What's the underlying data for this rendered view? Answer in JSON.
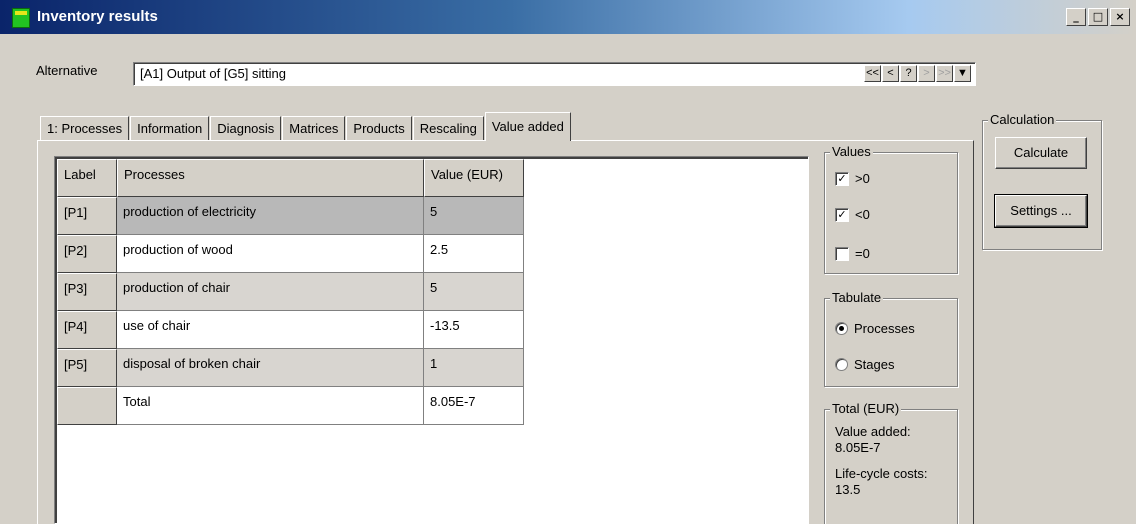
{
  "window": {
    "title": "Inventory results",
    "minimize": "_",
    "maximize": "□",
    "close": "×"
  },
  "alternative": {
    "label": "Alternative",
    "value": "[A1] Output of [G5] sitting",
    "nav": [
      "<<",
      "<",
      "?",
      ">",
      ">>",
      "▼"
    ]
  },
  "tabs": [
    {
      "label": "1: Processes"
    },
    {
      "label": "Information"
    },
    {
      "label": "Diagnosis"
    },
    {
      "label": "Matrices"
    },
    {
      "label": "Products"
    },
    {
      "label": "Rescaling"
    },
    {
      "label": "Value added"
    }
  ],
  "table": {
    "headers": [
      "Label",
      "Processes",
      "Value (EUR)"
    ],
    "rows": [
      {
        "label": "[P1]",
        "process": "production of electricity",
        "value": "5"
      },
      {
        "label": "[P2]",
        "process": "production of wood",
        "value": "2.5"
      },
      {
        "label": "[P3]",
        "process": "production of chair",
        "value": "5"
      },
      {
        "label": "[P4]",
        "process": "use of chair",
        "value": "-13.5"
      },
      {
        "label": "[P5]",
        "process": "disposal of broken chair",
        "value": "1"
      },
      {
        "label": "",
        "process": "Total",
        "value": "8.05E-7"
      }
    ]
  },
  "values_group": {
    "title": "Values",
    "options": [
      {
        "label": ">0",
        "checked": true,
        "mark": "✓"
      },
      {
        "label": "<0",
        "checked": true,
        "mark": "✓"
      },
      {
        "label": "=0",
        "checked": false,
        "mark": ""
      }
    ]
  },
  "tabulate_group": {
    "title": "Tabulate",
    "options": [
      {
        "label": "Processes",
        "selected": true
      },
      {
        "label": "Stages",
        "selected": false
      }
    ]
  },
  "total_group": {
    "title": "Total (EUR)",
    "value_added_label": "Value added:",
    "value_added": "8.05E-7",
    "lcc_label": "Life-cycle costs:",
    "lcc": "13.5"
  },
  "calculation": {
    "title": "Calculation",
    "calculate": "Calculate",
    "settings": "Settings ..."
  }
}
